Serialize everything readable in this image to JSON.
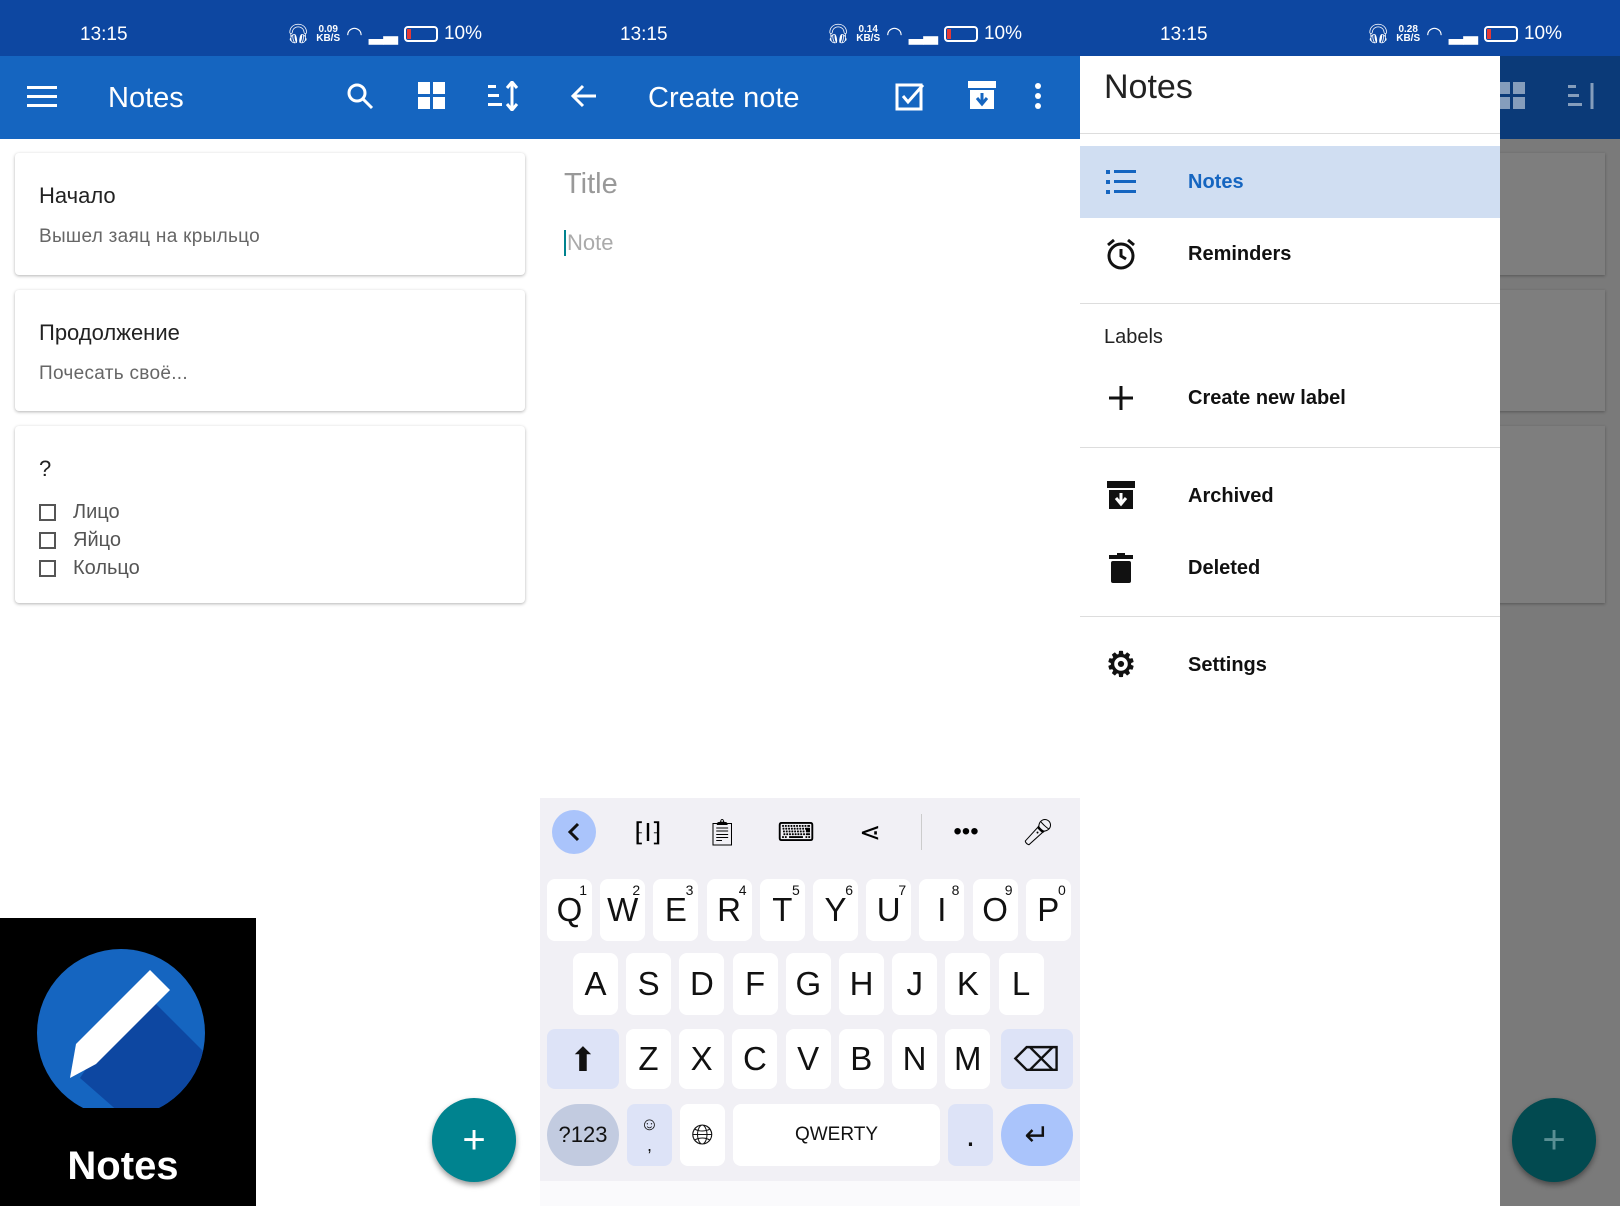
{
  "status_bars": [
    {
      "time": "13:15",
      "speed": "0.09",
      "speed_unit": "KB/S",
      "battery": "10%"
    },
    {
      "time": "13:15",
      "speed": "0.14",
      "speed_unit": "KB/S",
      "battery": "10%"
    },
    {
      "time": "13:15",
      "speed": "0.28",
      "speed_unit": "KB/S",
      "battery": "10%"
    }
  ],
  "list_screen": {
    "title": "Notes",
    "notes": [
      {
        "title": "Начало",
        "body": "Вышел заяц на крыльцо"
      },
      {
        "title": "Продолжение",
        "body": "Почесать своё..."
      },
      {
        "title": "?",
        "items": [
          "Лицо",
          "Яйцо",
          "Кольцо"
        ]
      }
    ],
    "fab": "+",
    "logo_label": "Notes"
  },
  "editor_screen": {
    "title": "Create note",
    "title_placeholder": "Title",
    "note_placeholder": "Note",
    "keyboard": {
      "row1": [
        "Q",
        "W",
        "E",
        "R",
        "T",
        "Y",
        "U",
        "I",
        "O",
        "P"
      ],
      "row1_nums": [
        "1",
        "2",
        "3",
        "4",
        "5",
        "6",
        "7",
        "8",
        "9",
        "0"
      ],
      "row2": [
        "A",
        "S",
        "D",
        "F",
        "G",
        "H",
        "J",
        "K",
        "L"
      ],
      "row3": [
        "Z",
        "X",
        "C",
        "V",
        "B",
        "N",
        "M"
      ],
      "symbols": "?123",
      "comma": ",",
      "space": "QWERTY",
      "period": "."
    }
  },
  "drawer": {
    "header": "Notes",
    "items": [
      {
        "label": "Notes",
        "icon": "list-icon"
      },
      {
        "label": "Reminders",
        "icon": "alarm-icon"
      }
    ],
    "labels_heading": "Labels",
    "create_label": "Create new label",
    "archived": "Archived",
    "deleted": "Deleted",
    "settings": "Settings",
    "fab": "+"
  },
  "colors": {
    "status_bar": "#0d47a1",
    "app_bar": "#1565c0",
    "fab": "#00838f",
    "drawer_selected": "#d0def2"
  }
}
